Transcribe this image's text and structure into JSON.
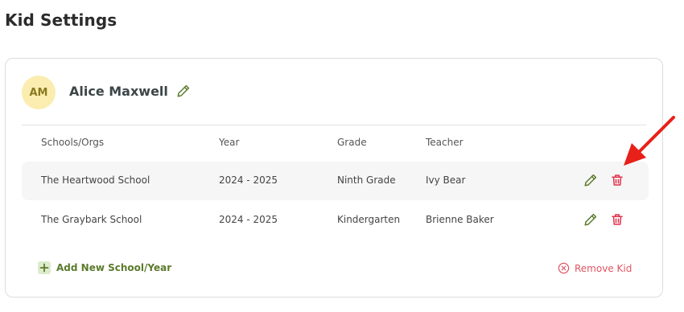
{
  "page": {
    "title": "Kid Settings"
  },
  "kid": {
    "initials": "AM",
    "name": "Alice Maxwell"
  },
  "table": {
    "headers": {
      "school": "Schools/Orgs",
      "year": "Year",
      "grade": "Grade",
      "teacher": "Teacher"
    },
    "rows": [
      {
        "school": "The Heartwood School",
        "year": "2024 - 2025",
        "grade": "Ninth Grade",
        "teacher": "Ivy Bear"
      },
      {
        "school": "The Graybark School",
        "year": "2024 - 2025",
        "grade": "Kindergarten",
        "teacher": "Brienne Baker"
      }
    ]
  },
  "actions": {
    "add_label": "Add New School/Year",
    "remove_label": "Remove Kid"
  },
  "colors": {
    "accent_green": "#5c7a2e",
    "delete_red": "#e0334a",
    "avatar_bg": "#fbedb0",
    "row_highlight": "#f6f6f6",
    "annotation_arrow": "#e8201a"
  },
  "icons": {
    "edit": "pencil-icon",
    "delete": "trash-icon",
    "add": "plus-icon",
    "remove": "circle-x-icon"
  }
}
